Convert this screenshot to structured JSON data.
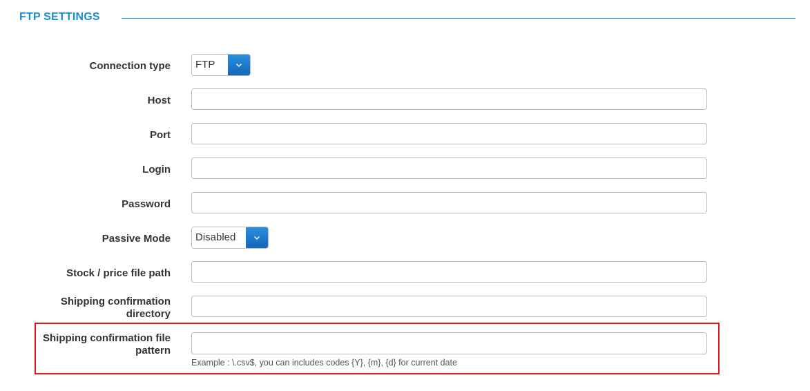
{
  "section": {
    "title": "FTP SETTINGS"
  },
  "form": {
    "connection_type": {
      "label": "Connection type",
      "value": "FTP"
    },
    "host": {
      "label": "Host",
      "value": ""
    },
    "port": {
      "label": "Port",
      "value": ""
    },
    "login": {
      "label": "Login",
      "value": ""
    },
    "password": {
      "label": "Password",
      "value": ""
    },
    "passive_mode": {
      "label": "Passive Mode",
      "value": "Disabled"
    },
    "stock_price_path": {
      "label": "Stock / price file path",
      "value": ""
    },
    "shipping_directory": {
      "label": "Shipping confirmation directory",
      "value": ""
    },
    "shipping_pattern": {
      "label": "Shipping confirmation file pattern",
      "value": "",
      "help": "Example : \\.csv$, you can includes codes {Y}, {m}, {d} for current date"
    }
  },
  "icons": {
    "dropdown": "chevron-down-icon"
  },
  "colors": {
    "accent": "#1a8dcf",
    "select_button": "#1a78c8",
    "highlight": "#e01818"
  }
}
